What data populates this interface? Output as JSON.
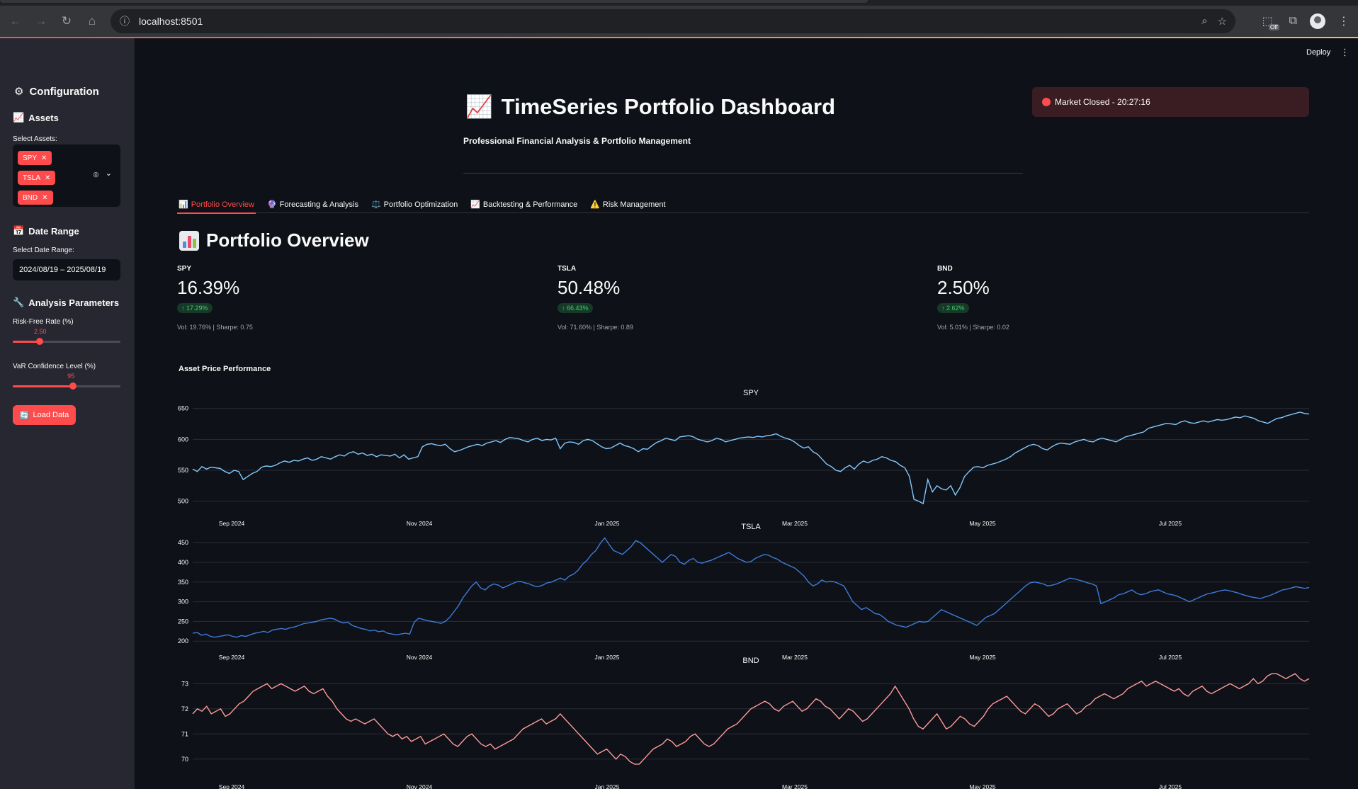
{
  "browser": {
    "url": "localhost:8501",
    "ext_badge": "Off"
  },
  "header": {
    "deploy_label": "Deploy",
    "kebab": "⋮",
    "title_icon": "📈",
    "title": "TimeSeries Portfolio Dashboard",
    "subtitle": "Professional Financial Analysis & Portfolio Management",
    "market_status": "Market Closed - 20:27:16"
  },
  "sidebar": {
    "config_title": "Configuration",
    "assets_title": "Assets",
    "select_assets_label": "Select Assets:",
    "selected_assets": [
      "SPY",
      "TSLA",
      "BND"
    ],
    "date_title": "Date Range",
    "date_label": "Select Date Range:",
    "date_value": "2024/08/19 – 2025/08/19",
    "params_title": "Analysis Parameters",
    "risk_free_label": "Risk-Free Rate (%)",
    "risk_free_value": "2.50",
    "risk_free_fraction": 0.25,
    "var_label": "VaR Confidence Level (%)",
    "var_value": "95",
    "var_fraction": 0.56,
    "load_button": "Load Data"
  },
  "tabs": [
    {
      "icon": "📊",
      "label": "Portfolio Overview",
      "active": true
    },
    {
      "icon": "🔮",
      "label": "Forecasting & Analysis",
      "active": false
    },
    {
      "icon": "⚖️",
      "label": "Portfolio Optimization",
      "active": false
    },
    {
      "icon": "📈",
      "label": "Backtesting & Performance",
      "active": false
    },
    {
      "icon": "⚠️",
      "label": "Risk Management",
      "active": false
    }
  ],
  "overview": {
    "title": "Portfolio Overview",
    "metrics": [
      {
        "label": "SPY",
        "value": "16.39%",
        "delta": "↑ 17.29%",
        "note": "Vol: 19.76% | Sharpe: 0.75"
      },
      {
        "label": "TSLA",
        "value": "50.48%",
        "delta": "↑ 66.43%",
        "note": "Vol: 71.60% | Sharpe: 0.89"
      },
      {
        "label": "BND",
        "value": "2.50%",
        "delta": "↑ 2.62%",
        "note": "Vol: 5.01% | Sharpe: 0.02"
      }
    ],
    "chart_heading": "Asset Price Performance"
  },
  "chart_data": [
    {
      "type": "line",
      "title": "SPY",
      "x_ticks": [
        "Sep 2024",
        "Nov 2024",
        "Jan 2025",
        "Mar 2025",
        "May 2025",
        "Jul 2025"
      ],
      "y_ticks": [
        500,
        550,
        600,
        650
      ],
      "ylim": [
        495,
        660
      ],
      "color": "#83c9ff",
      "y": [
        552,
        548,
        556,
        552,
        555,
        554,
        553,
        548,
        545,
        550,
        548,
        535,
        540,
        545,
        548,
        555,
        557,
        556,
        558,
        562,
        565,
        563,
        566,
        565,
        568,
        570,
        566,
        568,
        572,
        570,
        568,
        572,
        575,
        573,
        578,
        580,
        576,
        578,
        574,
        576,
        572,
        575,
        574,
        573,
        576,
        570,
        575,
        568,
        570,
        572,
        588,
        592,
        593,
        591,
        590,
        592,
        585,
        580,
        582,
        585,
        588,
        590,
        592,
        590,
        594,
        596,
        598,
        595,
        600,
        603,
        602,
        601,
        598,
        596,
        600,
        602,
        598,
        600,
        599,
        602,
        585,
        594,
        596,
        595,
        592,
        598,
        600,
        598,
        593,
        588,
        585,
        586,
        590,
        594,
        590,
        588,
        585,
        580,
        585,
        584,
        590,
        595,
        598,
        602,
        600,
        598,
        604,
        605,
        606,
        604,
        600,
        598,
        596,
        598,
        602,
        600,
        596,
        598,
        600,
        602,
        603,
        604,
        603,
        605,
        604,
        606,
        607,
        609,
        605,
        602,
        600,
        596,
        590,
        586,
        588,
        580,
        576,
        568,
        560,
        556,
        550,
        548,
        554,
        558,
        552,
        560,
        565,
        562,
        566,
        568,
        572,
        570,
        566,
        564,
        558,
        554,
        540,
        503,
        500,
        496,
        535,
        515,
        525,
        520,
        518,
        525,
        510,
        522,
        540,
        548,
        555,
        556,
        554,
        558,
        560,
        562,
        565,
        568,
        572,
        578,
        582,
        586,
        590,
        592,
        590,
        585,
        583,
        588,
        592,
        594,
        593,
        592,
        596,
        598,
        600,
        597,
        596,
        600,
        602,
        600,
        598,
        596,
        600,
        604,
        606,
        608,
        610,
        612,
        618,
        620,
        622,
        624,
        626,
        625,
        624,
        628,
        630,
        627,
        626,
        628,
        630,
        628,
        630,
        632,
        631,
        632,
        634,
        636,
        635,
        638,
        636,
        634,
        630,
        628,
        626,
        630,
        634,
        635,
        638,
        640,
        642,
        644,
        642,
        641
      ]
    },
    {
      "type": "line",
      "title": "TSLA",
      "x_ticks": [
        "Sep 2024",
        "Nov 2024",
        "Jan 2025",
        "Mar 2025",
        "May 2025",
        "Jul 2025"
      ],
      "y_ticks": [
        200,
        250,
        300,
        350,
        400,
        450
      ],
      "ylim": [
        195,
        470
      ],
      "color": "#3d7bd9",
      "y": [
        220,
        222,
        215,
        218,
        212,
        210,
        212,
        214,
        216,
        212,
        210,
        214,
        212,
        216,
        220,
        222,
        225,
        222,
        228,
        230,
        232,
        230,
        234,
        236,
        240,
        244,
        246,
        248,
        250,
        254,
        256,
        258,
        256,
        250,
        246,
        248,
        240,
        236,
        232,
        230,
        226,
        228,
        224,
        226,
        220,
        218,
        216,
        218,
        220,
        218,
        248,
        258,
        255,
        252,
        250,
        248,
        245,
        250,
        260,
        275,
        290,
        310,
        325,
        340,
        350,
        335,
        330,
        340,
        345,
        342,
        335,
        340,
        345,
        350,
        352,
        348,
        345,
        340,
        338,
        342,
        348,
        350,
        355,
        360,
        355,
        365,
        370,
        380,
        395,
        405,
        420,
        430,
        448,
        462,
        445,
        430,
        425,
        420,
        430,
        440,
        455,
        450,
        440,
        430,
        420,
        410,
        400,
        410,
        420,
        415,
        400,
        395,
        405,
        410,
        400,
        398,
        402,
        405,
        410,
        415,
        420,
        425,
        418,
        410,
        405,
        400,
        402,
        410,
        415,
        420,
        418,
        412,
        408,
        400,
        395,
        390,
        385,
        375,
        365,
        350,
        340,
        345,
        355,
        350,
        352,
        350,
        345,
        340,
        320,
        300,
        290,
        280,
        285,
        278,
        270,
        268,
        260,
        250,
        245,
        240,
        238,
        235,
        240,
        245,
        250,
        248,
        250,
        260,
        270,
        280,
        275,
        270,
        265,
        260,
        255,
        250,
        245,
        240,
        250,
        260,
        265,
        270,
        280,
        290,
        300,
        310,
        320,
        330,
        340,
        348,
        350,
        348,
        345,
        340,
        342,
        345,
        350,
        355,
        360,
        358,
        355,
        352,
        348,
        345,
        340,
        295,
        300,
        305,
        310,
        318,
        320,
        325,
        330,
        322,
        318,
        320,
        325,
        328,
        330,
        325,
        320,
        318,
        315,
        310,
        305,
        300,
        305,
        310,
        315,
        320,
        322,
        325,
        328,
        330,
        328,
        325,
        322,
        318,
        315,
        312,
        310,
        308,
        312,
        315,
        320,
        325,
        330,
        332,
        335,
        338,
        336,
        334,
        336
      ]
    },
    {
      "type": "line",
      "title": "BND",
      "x_ticks": [
        "Sep 2024",
        "Nov 2024",
        "Jan 2025",
        "Mar 2025",
        "May 2025",
        "Jul 2025"
      ],
      "y_ticks": [
        70,
        71,
        72,
        73
      ],
      "ylim": [
        69.6,
        73.6
      ],
      "color": "#ff9b9b",
      "y": [
        71.8,
        72.0,
        71.9,
        72.1,
        71.8,
        71.9,
        72.0,
        71.7,
        71.8,
        72.0,
        72.2,
        72.3,
        72.5,
        72.7,
        72.8,
        72.9,
        73.0,
        72.8,
        72.9,
        73.0,
        72.9,
        72.8,
        72.7,
        72.8,
        72.9,
        72.7,
        72.6,
        72.7,
        72.8,
        72.5,
        72.3,
        72.0,
        71.8,
        71.6,
        71.5,
        71.6,
        71.5,
        71.4,
        71.5,
        71.6,
        71.4,
        71.2,
        71.0,
        70.9,
        71.0,
        70.8,
        70.9,
        70.7,
        70.8,
        70.9,
        70.6,
        70.7,
        70.8,
        70.9,
        71.0,
        70.8,
        70.6,
        70.5,
        70.7,
        70.9,
        71.0,
        70.8,
        70.6,
        70.5,
        70.6,
        70.4,
        70.5,
        70.6,
        70.7,
        70.8,
        71.0,
        71.2,
        71.3,
        71.4,
        71.5,
        71.6,
        71.4,
        71.5,
        71.6,
        71.8,
        71.6,
        71.4,
        71.2,
        71.0,
        70.8,
        70.6,
        70.4,
        70.2,
        70.3,
        70.4,
        70.2,
        70.0,
        70.2,
        70.1,
        69.9,
        69.8,
        69.8,
        70.0,
        70.2,
        70.4,
        70.5,
        70.6,
        70.8,
        70.7,
        70.5,
        70.6,
        70.7,
        70.9,
        71.0,
        70.8,
        70.6,
        70.5,
        70.6,
        70.8,
        71.0,
        71.2,
        71.3,
        71.4,
        71.6,
        71.8,
        72.0,
        72.1,
        72.2,
        72.3,
        72.2,
        72.0,
        71.9,
        72.1,
        72.2,
        72.3,
        72.1,
        71.9,
        72.0,
        72.2,
        72.4,
        72.3,
        72.1,
        72.0,
        71.8,
        71.6,
        71.8,
        72.0,
        71.9,
        71.7,
        71.5,
        71.6,
        71.8,
        72.0,
        72.2,
        72.4,
        72.6,
        72.9,
        72.6,
        72.3,
        72.0,
        71.6,
        71.3,
        71.2,
        71.4,
        71.6,
        71.8,
        71.5,
        71.2,
        71.3,
        71.5,
        71.7,
        71.6,
        71.4,
        71.3,
        71.5,
        71.7,
        72.0,
        72.2,
        72.3,
        72.4,
        72.5,
        72.3,
        72.1,
        71.9,
        71.8,
        72.0,
        72.2,
        72.1,
        71.9,
        71.7,
        71.8,
        72.0,
        72.1,
        72.2,
        72.0,
        71.8,
        71.9,
        72.1,
        72.2,
        72.4,
        72.5,
        72.6,
        72.5,
        72.4,
        72.5,
        72.6,
        72.8,
        72.9,
        73.0,
        73.1,
        72.9,
        73.0,
        73.1,
        73.0,
        72.9,
        72.8,
        72.7,
        72.8,
        72.6,
        72.5,
        72.7,
        72.8,
        72.9,
        72.7,
        72.6,
        72.7,
        72.8,
        72.9,
        73.0,
        72.9,
        72.8,
        72.9,
        73.0,
        73.2,
        73.0,
        73.1,
        73.3,
        73.4,
        73.4,
        73.3,
        73.2,
        73.3,
        73.4,
        73.2,
        73.1,
        73.2
      ]
    }
  ]
}
